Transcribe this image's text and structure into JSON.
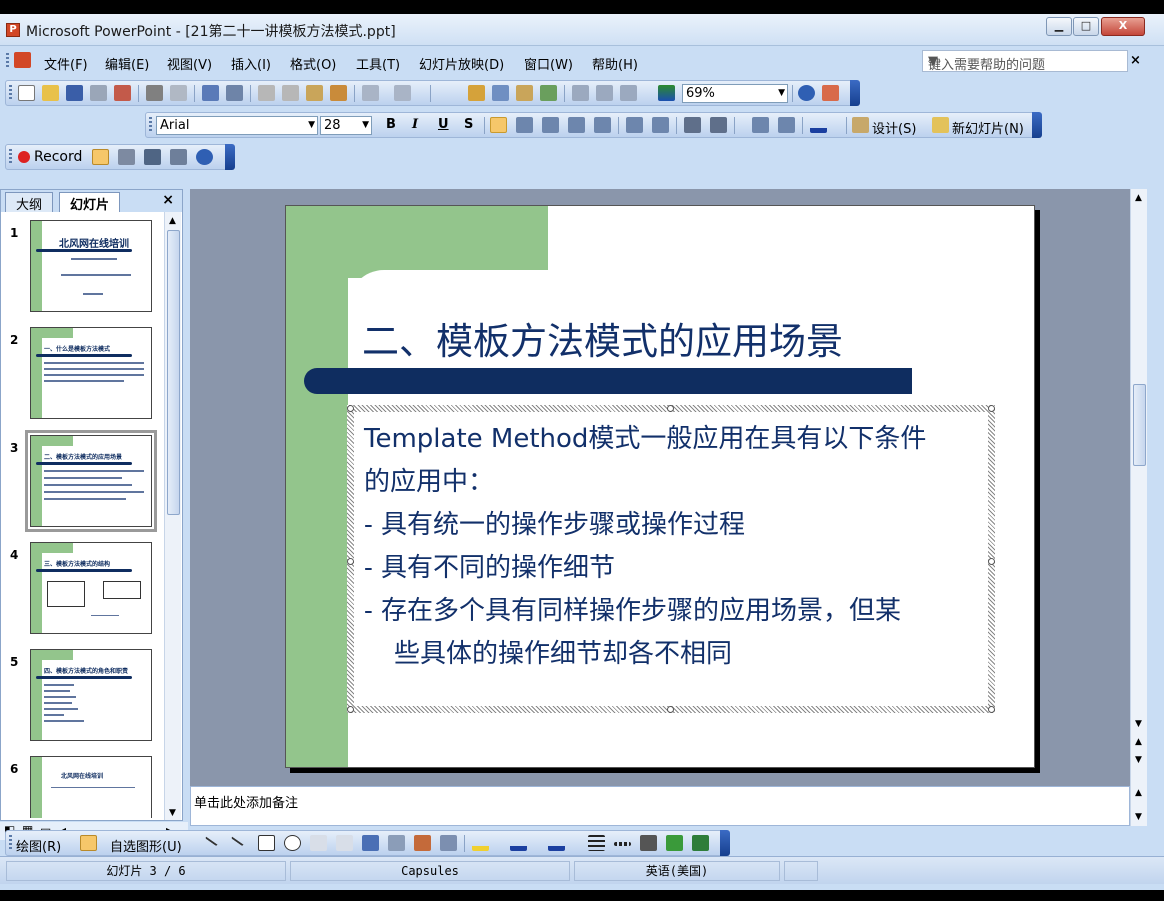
{
  "window": {
    "title": "Microsoft PowerPoint - [21第二十一讲模板方法模式.ppt]",
    "minimize": "▁",
    "maximize": "□",
    "close": "X"
  },
  "menubar": {
    "items": [
      "文件(F)",
      "编辑(E)",
      "视图(V)",
      "插入(I)",
      "格式(O)",
      "工具(T)",
      "幻灯片放映(D)",
      "窗口(W)",
      "帮助(H)"
    ],
    "help_placeholder": "键入需要帮助的问题",
    "close_label": "×"
  },
  "toolbar_standard": {
    "zoom": "69%"
  },
  "toolbar_format": {
    "font": "Arial",
    "size": "28",
    "bold": "B",
    "italic": "I",
    "underline": "U",
    "shadow": "S",
    "design_label": "设计(S)",
    "new_slide_label": "新幻灯片(N)"
  },
  "toolbar_record": {
    "record_label": "Record"
  },
  "outline_pane": {
    "tab_outline": "大纲",
    "tab_slides": "幻灯片",
    "close": "×",
    "slides": [
      {
        "num": "1",
        "title": "北风网在线培训"
      },
      {
        "num": "2",
        "title": "一、什么是模板方法模式"
      },
      {
        "num": "3",
        "title": "二、模板方法模式的应用场景"
      },
      {
        "num": "4",
        "title": "三、模板方法模式的结构"
      },
      {
        "num": "5",
        "title": "四、模板方法模式的角色和职责"
      },
      {
        "num": "6",
        "title": "北风网在线培训"
      }
    ]
  },
  "slide": {
    "title": "二、模板方法模式的应用场景",
    "body": {
      "line1_en": "Template Method",
      "line1_cn": "模式一般应用在具有以下条件",
      "line2": "的应用中：",
      "bullet1": "- 具有统一的操作步骤或操作过程",
      "bullet2": "- 具有不同的操作细节",
      "bullet3_a": "- 存在多个具有同样操作步骤的应用场景，但某",
      "bullet3_b": "些具体的操作细节却各不相同"
    }
  },
  "notes": {
    "placeholder": "单击此处添加备注"
  },
  "drawing_toolbar": {
    "draw_label": "绘图(R)",
    "autoshapes_label": "自选图形(U)"
  },
  "statusbar": {
    "slide_position": "幻灯片 3 / 6",
    "design": "Capsules",
    "language": "英语(美国)"
  }
}
